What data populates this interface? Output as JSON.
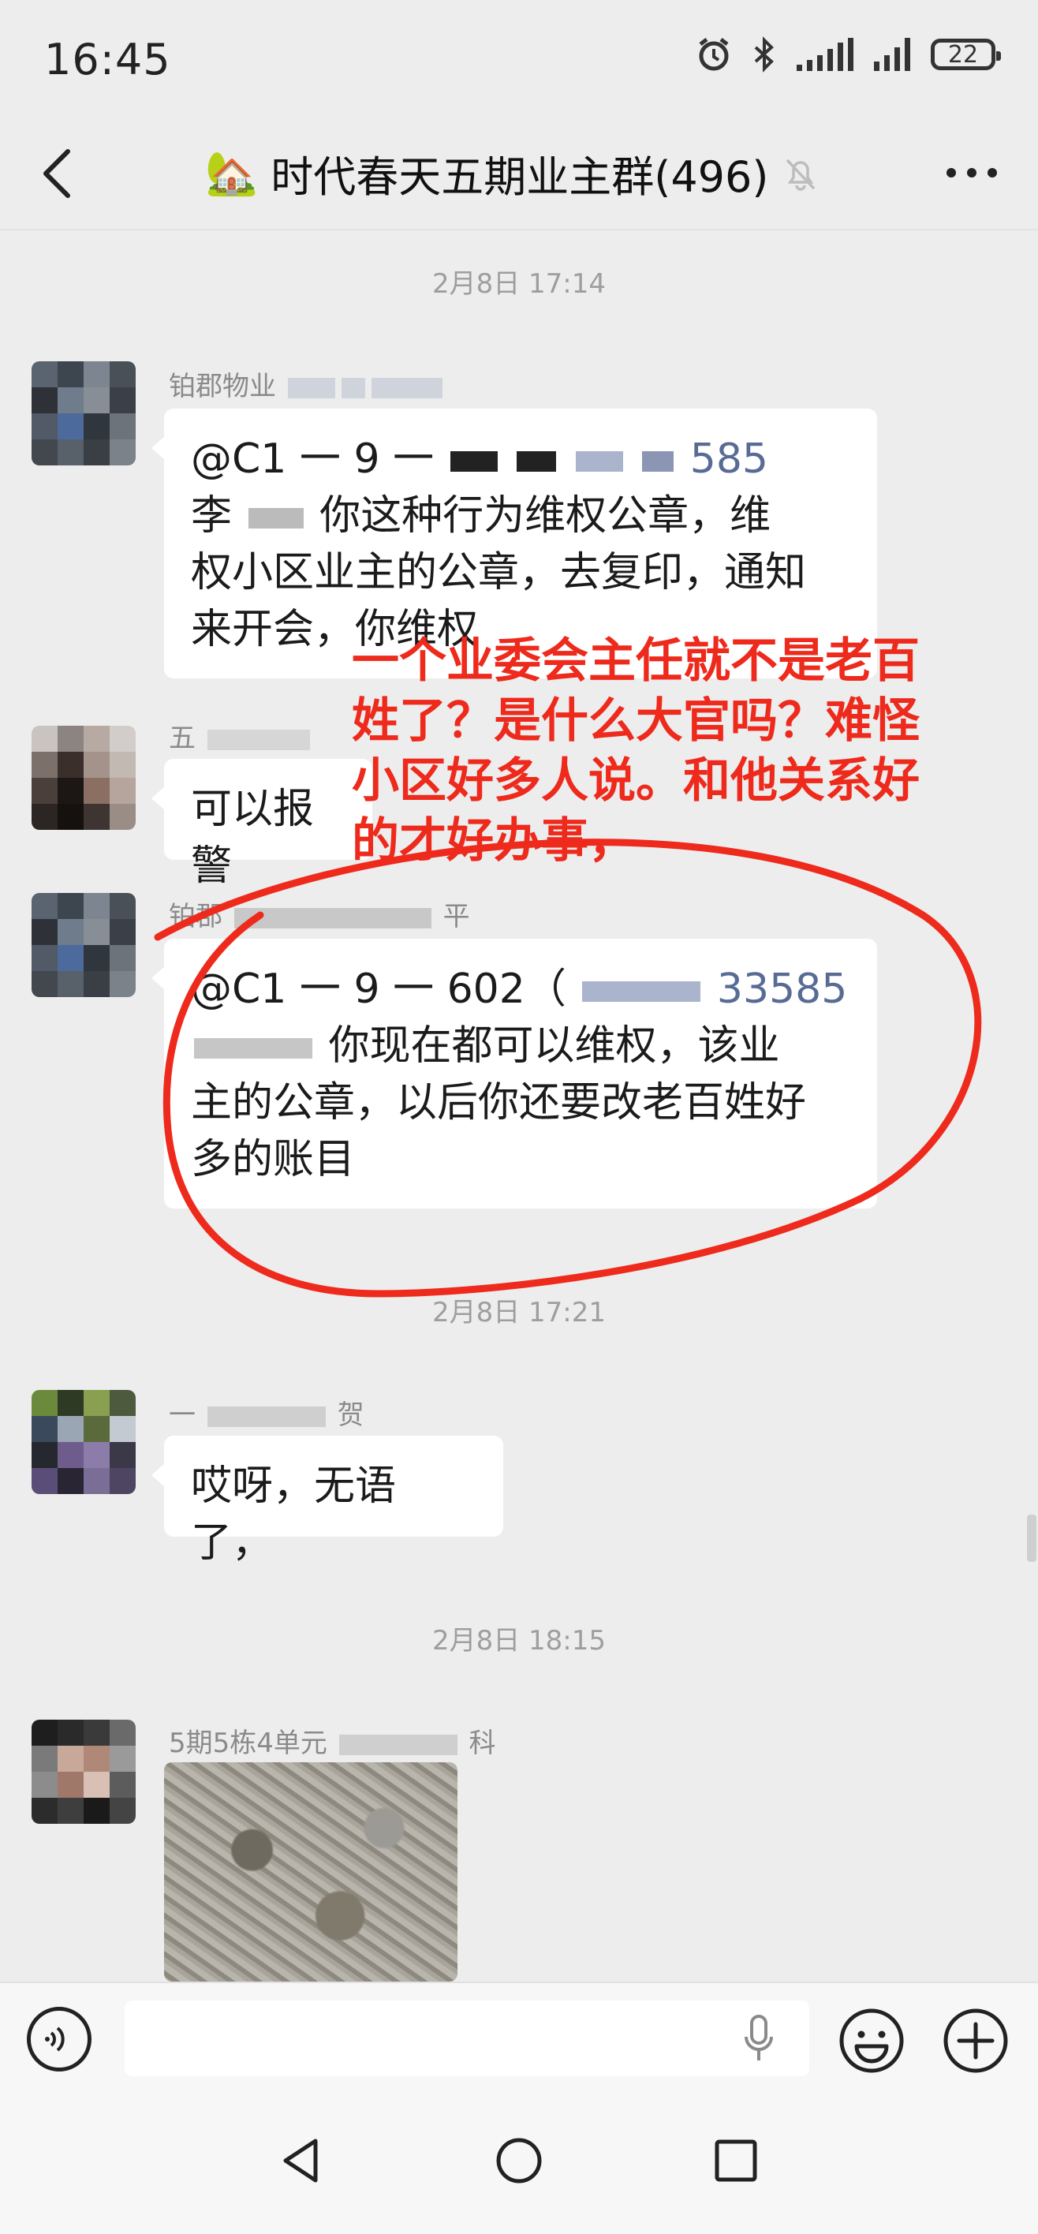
{
  "status_bar": {
    "time": "16:45",
    "battery": "22",
    "icons": [
      "alarm-icon",
      "bluetooth-icon",
      "signal-icon",
      "signal-icon",
      "battery-icon"
    ]
  },
  "header": {
    "title": "时代春天五期业主群(496)",
    "title_emoji": "🏡",
    "icons": [
      "back-arrow-icon",
      "mute-bell-icon",
      "more-dots-icon"
    ]
  },
  "messages": {
    "ts1": "2月8日 17:14",
    "m1": {
      "sender": "铂郡物业",
      "mention_head": "@C1 一 9 一",
      "mention_tail": "585",
      "line1_prefix": "李",
      "line1_text": "你这种行为维权公章，维",
      "line2": "权小区业主的公章，去复印，通知",
      "line3": "来开会，你维权"
    },
    "m2": {
      "sender": "五",
      "text": "可以报警"
    },
    "m3": {
      "sender_head": "铂郡",
      "sender_tail": "平",
      "mention_head": "@C1 一 9 一 602（",
      "mention_tail": "33585",
      "line1_text": "你现在都可以维权，该业",
      "line2": "主的公章，以后你还要改老百姓好",
      "line3": "多的账目"
    },
    "ts2": "2月8日 17:21",
    "m4": {
      "sender_head": "一",
      "sender_tail": "贺",
      "text": "哎呀，无语了，"
    },
    "ts3": "2月8日 18:15",
    "m5": {
      "sender_head": "5期5栋4单元",
      "sender_tail": "科"
    }
  },
  "annotation": {
    "line1": "一个业委会主任就不是老百",
    "line2": "姓了？是什么大官吗？难怪",
    "line3": "小区好多人说。和他关系好",
    "line4": "的才好办事，",
    "color": "#ee2a1c"
  },
  "input": {
    "placeholder": ""
  },
  "colors": {
    "background": "#ededed",
    "bubble": "#ffffff",
    "mention_link": "#576b95",
    "annotation": "#ee2a1c"
  }
}
